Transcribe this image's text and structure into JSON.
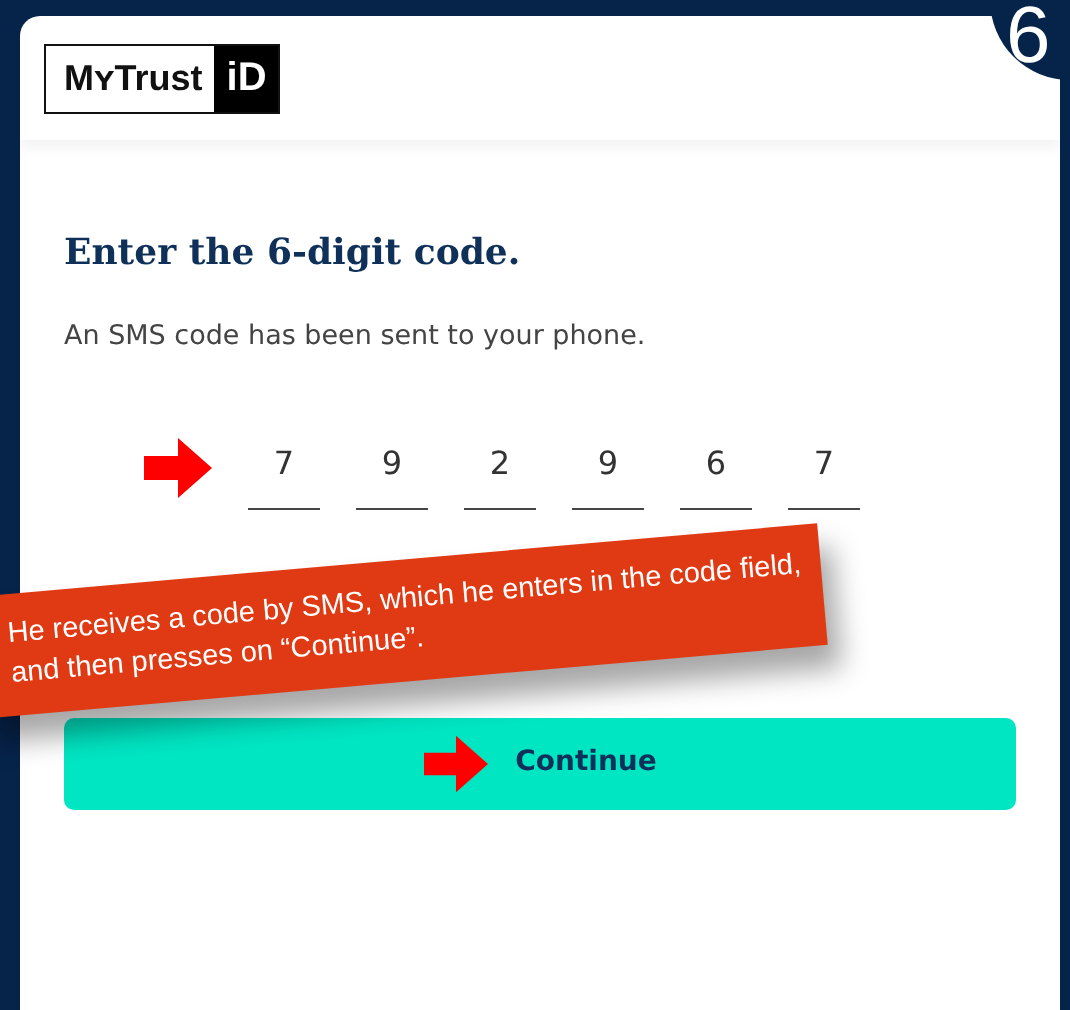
{
  "logo": {
    "wordmark": "MʏTrust",
    "mark": "iD"
  },
  "step_badge": "6",
  "heading": "Enter the 6-digit code.",
  "subtitle": "An SMS code has been sent to your phone.",
  "code_digits": [
    "7",
    "9",
    "2",
    "9",
    "6",
    "7"
  ],
  "callout": "He receives a code by SMS, which he enters in the code field, and then presses on “Continue”.",
  "button": {
    "label": "Continue"
  }
}
